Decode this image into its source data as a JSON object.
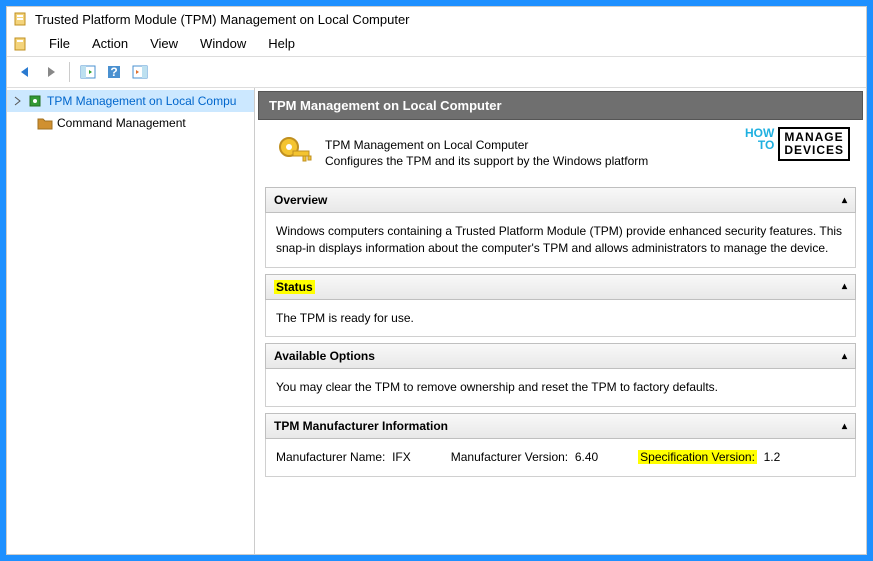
{
  "window": {
    "title": "Trusted Platform Module (TPM) Management on Local Computer"
  },
  "menu": {
    "file": "File",
    "action": "Action",
    "view": "View",
    "window": "Window",
    "help": "Help"
  },
  "tree": {
    "root": "TPM Management on Local Compu",
    "child": "Command Management"
  },
  "main": {
    "header": "TPM Management on Local Computer",
    "summary_title": "TPM Management on Local Computer",
    "summary_desc": "Configures the TPM and its support by the Windows platform"
  },
  "logo": {
    "left1": "HOW",
    "left2": "TO",
    "right1": "MANAGE",
    "right2": "DEVICES"
  },
  "overview": {
    "title": "Overview",
    "body": "Windows computers containing a Trusted Platform Module (TPM) provide enhanced security features. This snap-in displays information about the computer's TPM and allows administrators to manage the device."
  },
  "status": {
    "title": "Status",
    "body": "The TPM is ready for use."
  },
  "options": {
    "title": "Available Options",
    "body": "You may clear the TPM to remove ownership and reset the TPM to factory defaults."
  },
  "manufacturer": {
    "title": "TPM Manufacturer Information",
    "name_label": "Manufacturer Name:",
    "name_value": "IFX",
    "ver_label": "Manufacturer Version:",
    "ver_value": "6.40",
    "spec_label": "Specification Version:",
    "spec_value": "1.2"
  }
}
